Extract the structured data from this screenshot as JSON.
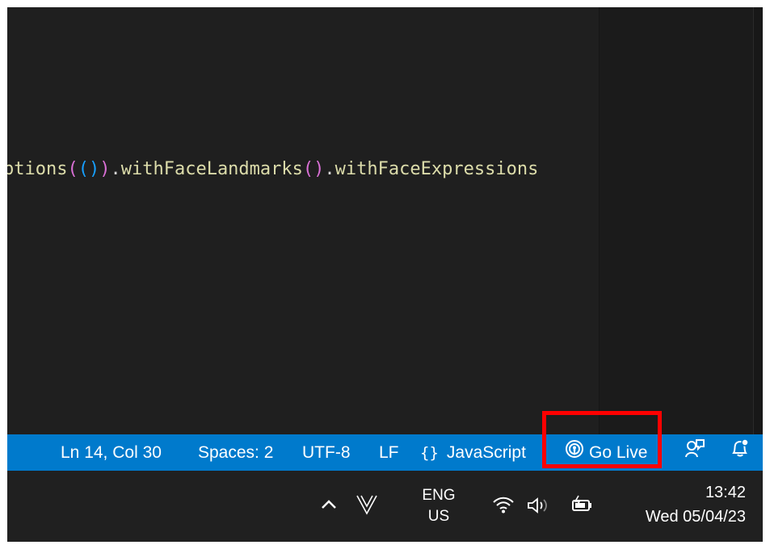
{
  "editor": {
    "code_tokens": [
      {
        "text": "ptions",
        "cls": "tok-fn"
      },
      {
        "text": "(",
        "cls": "tok-paren1"
      },
      {
        "text": "()",
        "cls": "tok-paren2"
      },
      {
        "text": ")",
        "cls": "tok-paren1"
      },
      {
        "text": ".",
        "cls": "tok-punc"
      },
      {
        "text": "withFaceLandmarks",
        "cls": "tok-fn"
      },
      {
        "text": "()",
        "cls": "tok-paren1"
      },
      {
        "text": ".",
        "cls": "tok-punc"
      },
      {
        "text": "withFaceExpressions",
        "cls": "tok-fn"
      }
    ]
  },
  "statusbar": {
    "background": "#007acc",
    "position_label": "Ln 14, Col 30",
    "indent_label": "Spaces: 2",
    "encoding_label": "UTF-8",
    "eol_label": "LF",
    "language_icon": "{}",
    "language_label": "JavaScript",
    "golive_icon": "broadcast-icon",
    "golive_label": "Go Live",
    "feedback_icon": "person-feedback-icon",
    "notifications_icon": "bell-dot-icon",
    "highlight_color": "#ff0000"
  },
  "taskbar": {
    "overflow_icon": "chevron-up-icon",
    "app_icon": "V-app-icon",
    "language_line1": "ENG",
    "language_line2": "US",
    "wifi_icon": "wifi-icon",
    "volume_icon": "volume-icon",
    "battery_icon": "battery-charging-icon",
    "time": "13:42",
    "date": "Wed 05/04/23"
  }
}
